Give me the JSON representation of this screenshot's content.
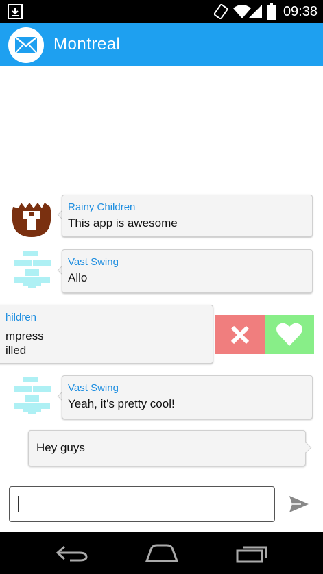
{
  "status_bar": {
    "time": "09:38",
    "icons": [
      "download-icon",
      "rotate-icon",
      "wifi-icon",
      "signal-icon",
      "battery-icon"
    ]
  },
  "app_bar": {
    "title": "Montreal",
    "logo_icon": "envelope-icon",
    "color": "#1ea0f0"
  },
  "messages": [
    {
      "sender": "Rainy Children",
      "text": "This app is awesome",
      "avatar": "brown-tower-avatar"
    },
    {
      "sender": "Vast Swing",
      "text": "Allo",
      "avatar": "cyan-block-avatar"
    },
    {
      "sender": "hildren",
      "text_line1": "mpress",
      "text_line2": "illed",
      "avatar": ""
    },
    {
      "sender": "Vast Swing",
      "text": "Yeah, it's pretty cool!",
      "avatar": "cyan-block-avatar"
    },
    {
      "text": "Hey guys"
    }
  ],
  "swipe_actions": {
    "dismiss_icon": "close-icon",
    "dismiss_color": "#f07e7e",
    "like_icon": "heart-icon",
    "like_color": "#88ee88"
  },
  "composer": {
    "value": "",
    "send_icon": "send-icon"
  },
  "nav_bar": {
    "icons": [
      "back-icon",
      "home-icon",
      "recents-icon"
    ]
  },
  "colors": {
    "sender_name": "#1e8ee0",
    "bubble_bg": "#f4f4f4"
  }
}
